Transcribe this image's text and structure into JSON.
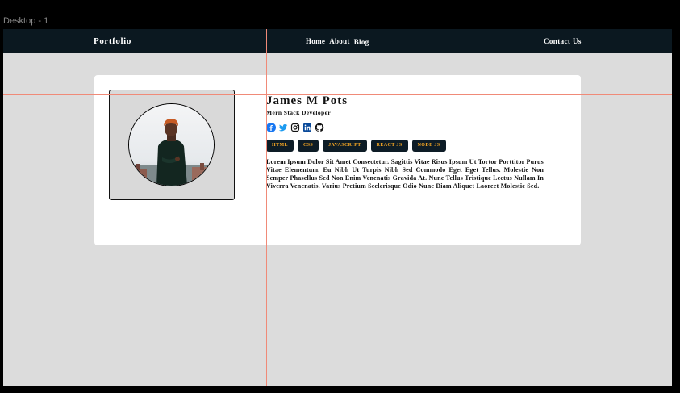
{
  "canvas": {
    "frame_label": "Desktop - 1"
  },
  "navbar": {
    "brand": "Portfolio",
    "links": [
      "Home",
      "About",
      "Blog"
    ],
    "contact": "Contact Us",
    "background": "#0b1820"
  },
  "profile": {
    "name": "James M Pots",
    "role": "Mern Stack Developer",
    "socials": [
      "facebook-icon",
      "twitter-icon",
      "instagram-icon",
      "linkedin-icon",
      "github-icon"
    ],
    "skills": [
      "HTML",
      "CSS",
      "JAVASCRIPT",
      "REACT JS",
      "NODE JS"
    ],
    "bio": "Lorem Ipsum Dolor Sit Amet Consectetur. Sagittis Vitae Risus Ipsum Ut Tortor Porttitor Purus Vitae Elementum. Eu Nibh Ut Turpis Nibh Sed Commodo Eget Eget Tellus. Molestie Non Semper Phasellus Sed Non Enim Venenatis Gravida At. Nunc Tellus Tristique Lectus Nullam In Viverra Venenatis. Varius Pretium Scelerisque Odio Nunc Diam Aliquet Laoreet Molestie Sed."
  },
  "colors": {
    "accent": "#f5a623",
    "tag_bg": "#0d1c26",
    "canvas_bg": "#dcdcdc",
    "guide": "#f08a78"
  }
}
